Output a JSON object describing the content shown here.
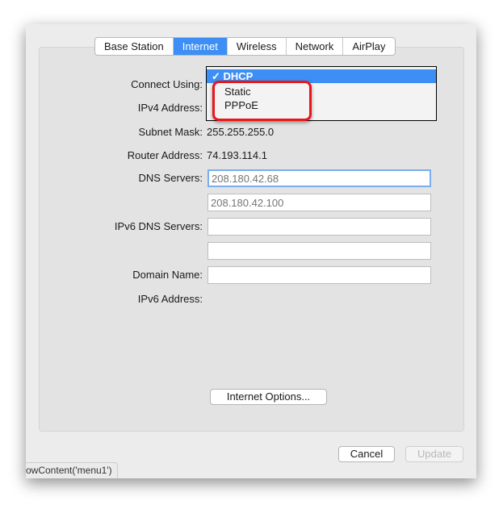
{
  "tabs": [
    "Base Station",
    "Internet",
    "Wireless",
    "Network",
    "AirPlay"
  ],
  "active_tab": "Internet",
  "form": {
    "connect_using_label": "Connect Using:",
    "connect_options": [
      "DHCP",
      "Static",
      "PPPoE"
    ],
    "connect_selected": "DHCP",
    "ipv4_label": "IPv4 Address:",
    "subnet_label": "Subnet Mask:",
    "subnet_value": "255.255.255.0",
    "router_label": "Router Address:",
    "router_value": "74.193.114.1",
    "dns_label": "DNS Servers:",
    "dns1_placeholder": "208.180.42.68",
    "dns2_placeholder": "208.180.42.100",
    "ipv6dns_label": "IPv6 DNS Servers:",
    "domain_label": "Domain Name:",
    "ipv6_label": "IPv6 Address:"
  },
  "buttons": {
    "internet_options": "Internet Options...",
    "cancel": "Cancel",
    "update": "Update"
  },
  "status_text": "owContent('menu1')",
  "colors": {
    "accent": "#3d8ff5",
    "highlight": "#e8151b"
  }
}
